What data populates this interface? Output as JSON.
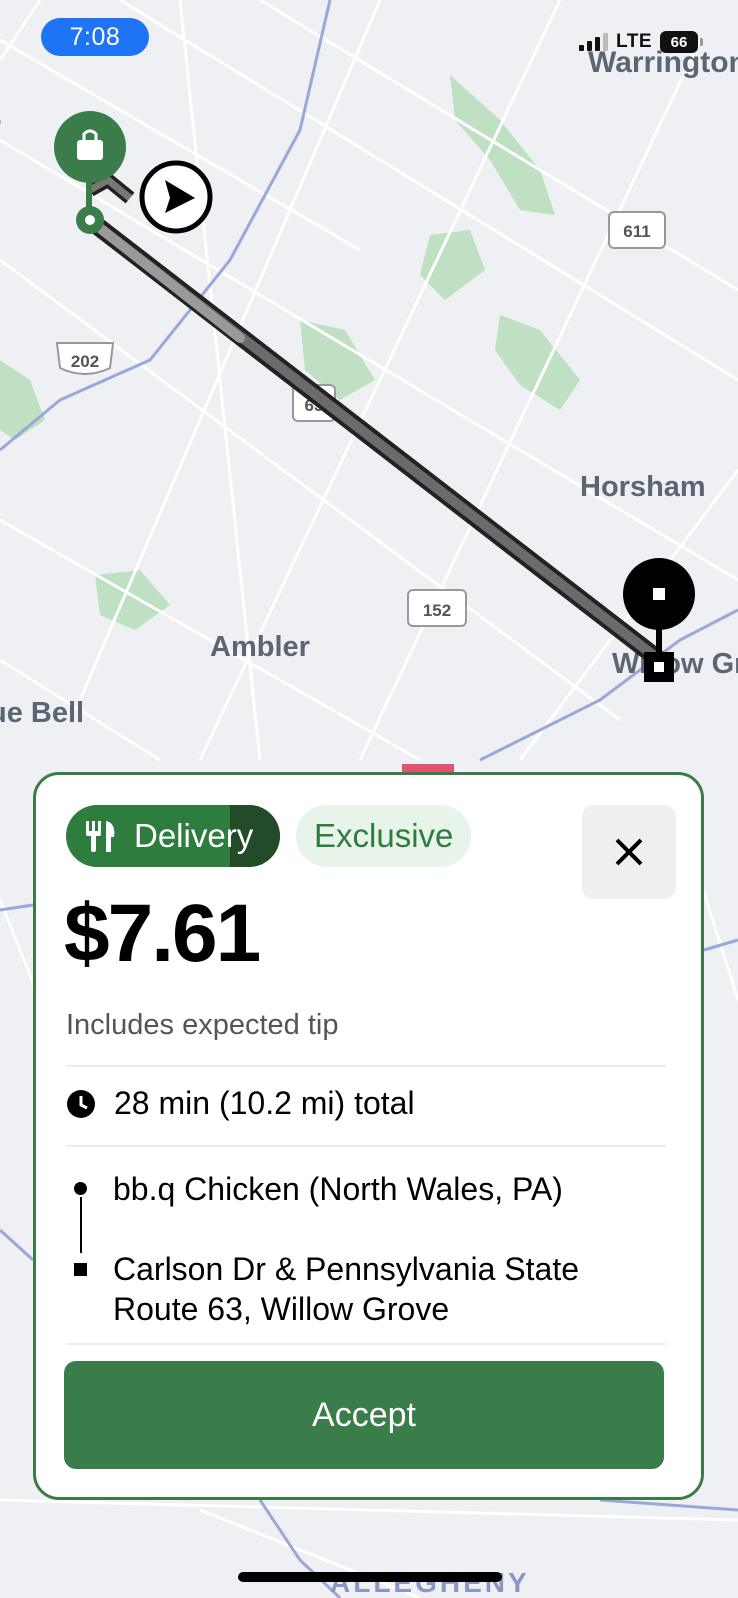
{
  "status_bar": {
    "time": "7:08",
    "network": "LTE",
    "battery": "66"
  },
  "map": {
    "places": [
      "Warrington",
      "Horsham",
      "Ambler",
      "Willow Grove",
      "Blue Bell",
      "ALLEGHENY"
    ],
    "route_shields": [
      "611",
      "202",
      "63",
      "152"
    ]
  },
  "offer": {
    "type_label": "Delivery",
    "exclusive_label": "Exclusive",
    "price": "$7.61",
    "price_note": "Includes expected tip",
    "trip_summary": "28 min (10.2 mi) total",
    "pickup": "bb.q Chicken (North Wales, PA)",
    "dropoff": "Carlson Dr & Pennsylvania State Route 63, Willow Grove",
    "accept_label": "Accept"
  },
  "colors": {
    "brand_green": "#3a7d4a",
    "status_blue": "#1f73f5"
  }
}
